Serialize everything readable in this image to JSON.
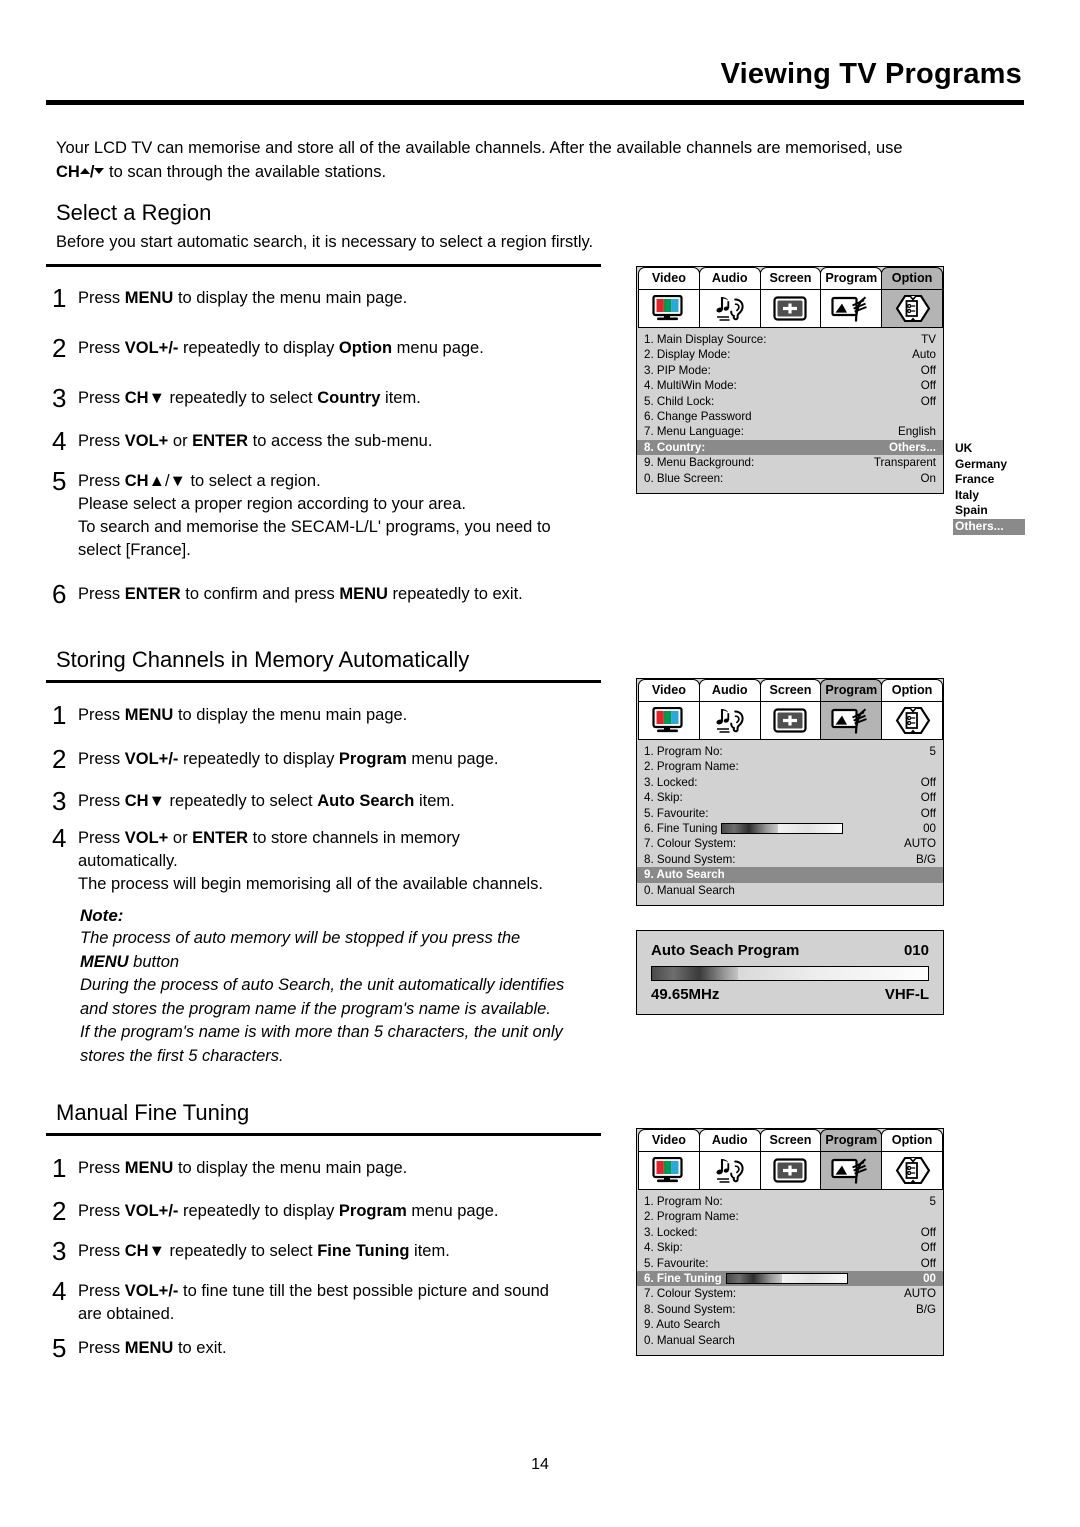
{
  "header": {
    "title": "Viewing TV Programs"
  },
  "intro": {
    "line1_a": "Your LCD TV can memorise and store all of the available channels. After the available channels are memorised, use",
    "line2_key": "CH",
    "line2_b": " to scan through the available stations."
  },
  "sections": [
    {
      "heading": "Select a Region",
      "lead": "Before you start automatic search, it is necessary to select a region firstly.",
      "steps": [
        {
          "num": "1",
          "lines": [
            [
              {
                "t": "Press "
              },
              {
                "t": "MENU",
                "b": true
              },
              {
                "t": " to display the menu main page."
              }
            ]
          ]
        },
        {
          "num": "2",
          "lines": [
            [
              {
                "t": "Press "
              },
              {
                "t": "VOL+/-",
                "b": true
              },
              {
                "t": " repeatedly to display "
              },
              {
                "t": "Option",
                "b": true
              },
              {
                "t": " menu page."
              }
            ]
          ]
        },
        {
          "num": "3",
          "lines": [
            [
              {
                "t": "Press "
              },
              {
                "t": "CH",
                "b": true
              },
              {
                "t": "▼ repeatedly to select "
              },
              {
                "t": "Country",
                "b": true
              },
              {
                "t": " item."
              }
            ]
          ]
        },
        {
          "num": "4",
          "lines": [
            [
              {
                "t": "Press "
              },
              {
                "t": "VOL+",
                "b": true
              },
              {
                "t": " or "
              },
              {
                "t": "ENTER",
                "b": true
              },
              {
                "t": " to access the sub-menu."
              }
            ]
          ]
        },
        {
          "num": "5",
          "lines": [
            [
              {
                "t": "Press "
              },
              {
                "t": "CH",
                "b": true
              },
              {
                "t": "▲/▼ to select a region."
              }
            ],
            [
              {
                "t": "Please select a proper region according to your area."
              }
            ],
            [
              {
                "t": "To search and memorise the SECAM-L/L' programs, you need to"
              }
            ],
            [
              {
                "t": "select [France]."
              }
            ]
          ]
        },
        {
          "num": "6",
          "lines": [
            [
              {
                "t": "Press "
              },
              {
                "t": "ENTER",
                "b": true
              },
              {
                "t": " to confirm and press "
              },
              {
                "t": "MENU",
                "b": true
              },
              {
                "t": " repeatedly to exit."
              }
            ]
          ]
        }
      ]
    },
    {
      "heading": "Storing Channels in Memory Automatically",
      "steps": [
        {
          "num": "1",
          "lines": [
            [
              {
                "t": "Press "
              },
              {
                "t": "MENU",
                "b": true
              },
              {
                "t": " to display the menu main page."
              }
            ]
          ]
        },
        {
          "num": "2",
          "lines": [
            [
              {
                "t": "Press "
              },
              {
                "t": "VOL+/-",
                "b": true
              },
              {
                "t": " repeatedly to display "
              },
              {
                "t": "Program",
                "b": true
              },
              {
                "t": " menu page."
              }
            ]
          ]
        },
        {
          "num": "3",
          "lines": [
            [
              {
                "t": "Press "
              },
              {
                "t": "CH",
                "b": true
              },
              {
                "t": "▼ repeatedly to select "
              },
              {
                "t": "Auto Search",
                "b": true
              },
              {
                "t": " item."
              }
            ]
          ]
        },
        {
          "num": "4",
          "lines": [
            [
              {
                "t": "Press "
              },
              {
                "t": "VOL+",
                "b": true
              },
              {
                "t": " or "
              },
              {
                "t": "ENTER",
                "b": true
              },
              {
                "t": " to store channels in memory"
              }
            ],
            [
              {
                "t": "automatically."
              }
            ],
            [
              {
                "t": "The process will begin memorising all of the available channels."
              }
            ]
          ]
        }
      ]
    },
    {
      "heading": "Manual Fine Tuning",
      "steps": [
        {
          "num": "1",
          "lines": [
            [
              {
                "t": "Press "
              },
              {
                "t": "MENU",
                "b": true
              },
              {
                "t": " to display the menu main page."
              }
            ]
          ]
        },
        {
          "num": "2",
          "lines": [
            [
              {
                "t": "Press "
              },
              {
                "t": "VOL+/-",
                "b": true
              },
              {
                "t": " repeatedly to display "
              },
              {
                "t": "Program",
                "b": true
              },
              {
                "t": " menu page."
              }
            ]
          ]
        },
        {
          "num": "3",
          "lines": [
            [
              {
                "t": "Press "
              },
              {
                "t": "CH",
                "b": true
              },
              {
                "t": "▼ repeatedly to select "
              },
              {
                "t": "Fine Tuning",
                "b": true
              },
              {
                "t": " item."
              }
            ]
          ]
        },
        {
          "num": "4",
          "lines": [
            [
              {
                "t": "Press "
              },
              {
                "t": "VOL+/-",
                "b": true
              },
              {
                "t": " to fine tune till the best possible picture and sound"
              }
            ],
            [
              {
                "t": "are obtained."
              }
            ]
          ]
        },
        {
          "num": "5",
          "lines": [
            [
              {
                "t": "Press "
              },
              {
                "t": "MENU",
                "b": true
              },
              {
                "t": " to exit."
              }
            ]
          ]
        }
      ]
    }
  ],
  "note": {
    "label": "Note:",
    "lines": [
      [
        {
          "t": "The process of auto memory will be stopped if you press the"
        }
      ],
      [
        {
          "t": "MENU",
          "b": true
        },
        {
          "t": " button"
        }
      ],
      [
        {
          "t": "During the process of auto Search, the unit automatically identifies"
        }
      ],
      [
        {
          "t": "and stores the program name if the program's name is available."
        }
      ],
      [
        {
          "t": "If the program's name is with more than 5 characters, the unit only"
        }
      ],
      [
        {
          "t": "stores the first 5 characters."
        }
      ]
    ]
  },
  "osd_tabs": {
    "labels": [
      "Video",
      "Audio",
      "Screen",
      "Program",
      "Option"
    ],
    "icons": [
      "tv-rgb-icon",
      "audio-note-ear-icon",
      "screen-crosshair-icon",
      "antenna-tv-icon",
      "option-list-icon"
    ]
  },
  "osd_option_menu": {
    "selected_tab": "Option",
    "selected_tab_index": 4,
    "rows": [
      {
        "key": "1. Main Display Source:",
        "value": "TV"
      },
      {
        "key": "2. Display Mode:",
        "value": "Auto"
      },
      {
        "key": "3. PIP Mode:",
        "value": "Off"
      },
      {
        "key": "4. MultiWin Mode:",
        "value": "Off"
      },
      {
        "key": "5. Child Lock:",
        "value": "Off"
      },
      {
        "key": "6. Change Password",
        "value": ""
      },
      {
        "key": "7. Menu Language:",
        "value": "English"
      },
      {
        "key": "8. Country:",
        "value": "Others...",
        "highlight": true
      },
      {
        "key": "9. Menu Background:",
        "value": "Transparent"
      },
      {
        "key": "0. Blue Screen:",
        "value": "On"
      }
    ]
  },
  "country_submenu": {
    "options": [
      {
        "label": "UK"
      },
      {
        "label": "Germany"
      },
      {
        "label": "France"
      },
      {
        "label": "Italy"
      },
      {
        "label": "Spain"
      },
      {
        "label": "Others...",
        "selected": true
      }
    ]
  },
  "osd_program_menu_auto": {
    "selected_tab": "Program",
    "selected_tab_index": 3,
    "rows": [
      {
        "key": "1. Program No:",
        "value": "5"
      },
      {
        "key": "2. Program Name:",
        "value": ""
      },
      {
        "key": "3. Locked:",
        "value": "Off"
      },
      {
        "key": "4. Skip:",
        "value": "Off"
      },
      {
        "key": "5. Favourite:",
        "value": "Off"
      },
      {
        "key": "6. Fine Tuning",
        "value": "00",
        "slider": 46
      },
      {
        "key": "7. Colour System:",
        "value": "AUTO"
      },
      {
        "key": "8. Sound System:",
        "value": "B/G"
      },
      {
        "key": "9. Auto Search",
        "value": "",
        "highlight": true
      },
      {
        "key": "0. Manual Search",
        "value": ""
      }
    ]
  },
  "osd_program_menu_fine": {
    "selected_tab": "Program",
    "selected_tab_index": 3,
    "rows": [
      {
        "key": "1. Program No:",
        "value": "5"
      },
      {
        "key": "2. Program Name:",
        "value": ""
      },
      {
        "key": "3. Locked:",
        "value": "Off"
      },
      {
        "key": "4. Skip:",
        "value": "Off"
      },
      {
        "key": "5. Favourite:",
        "value": "Off"
      },
      {
        "key": "6. Fine Tuning",
        "value": "00",
        "slider": 46,
        "highlight": true
      },
      {
        "key": "7. Colour System:",
        "value": "AUTO"
      },
      {
        "key": "8. Sound System:",
        "value": "B/G"
      },
      {
        "key": "9. Auto Search",
        "value": ""
      },
      {
        "key": "0. Manual Search",
        "value": ""
      }
    ]
  },
  "auto_search_panel": {
    "title": "Auto Seach Program",
    "program_number": "010",
    "frequency": "49.65MHz",
    "band": "VHF-L",
    "progress_percent": 31
  },
  "footer": {
    "page_number": "14"
  },
  "colors": {
    "osd_bg": "#d2d2d2",
    "osd_tab_selected": "#b4b4b4",
    "osd_highlight": "#8a8a8a",
    "icon_red": "#e8202a",
    "icon_green": "#009a4e",
    "icon_blue": "#29a8e0"
  }
}
